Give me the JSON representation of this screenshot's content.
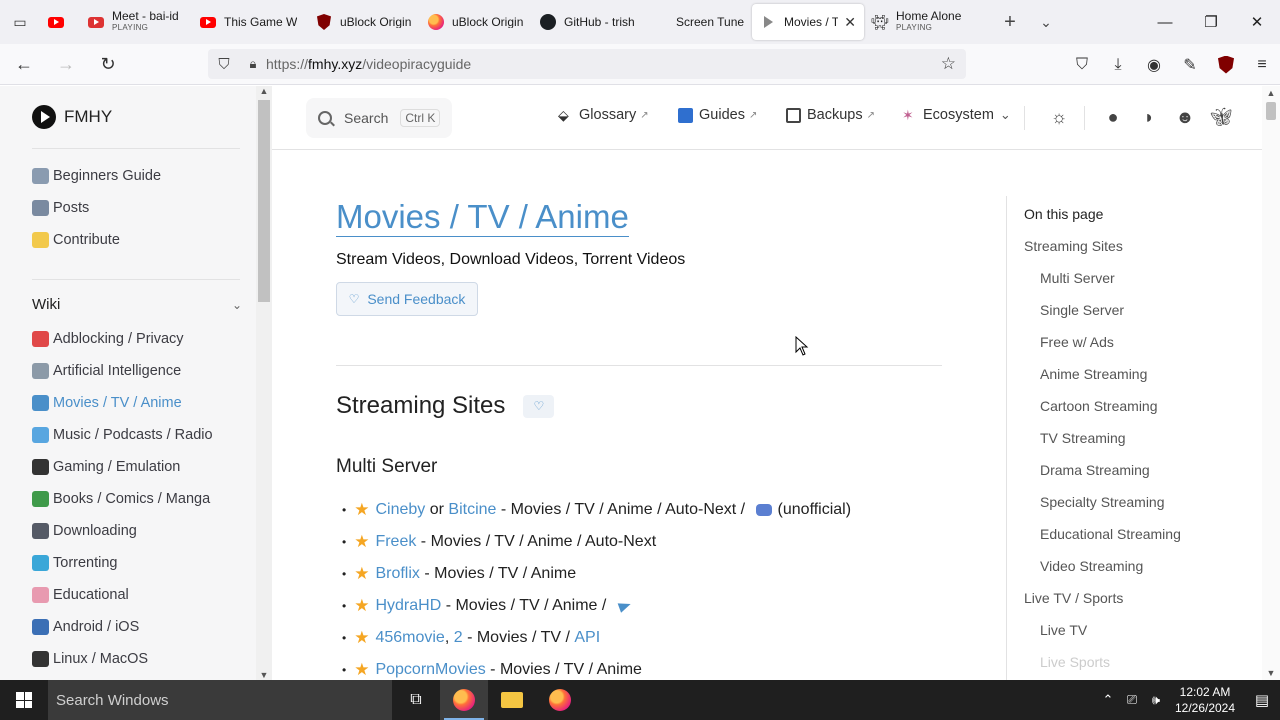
{
  "browser": {
    "tabs": [
      {
        "title": "",
        "icon": "youtube-icon",
        "active": false
      },
      {
        "title": "Meet - bai-id",
        "sub": "PLAYING",
        "icon": "meet-icon",
        "active": false
      },
      {
        "title": "This Game W",
        "icon": "youtube-icon",
        "active": false
      },
      {
        "title": "uBlock Origin",
        "icon": "ublock-icon",
        "active": false
      },
      {
        "title": "uBlock Origin",
        "icon": "firefox-icon",
        "active": false
      },
      {
        "title": "GitHub - trish",
        "icon": "github-icon",
        "active": false
      },
      {
        "title": "Screen Tunes",
        "icon": "screen-tunes-icon",
        "active": false
      },
      {
        "title": "Movies / TV",
        "icon": "play-icon",
        "active": true
      },
      {
        "title": "Home Alone",
        "sub": "PLAYING",
        "icon": "invader-icon",
        "active": false
      }
    ],
    "url_prefix": "https://",
    "url_domain": "fmhy.xyz",
    "url_path": "/videopiracyguide"
  },
  "site": {
    "brand": "FMHY",
    "search_label": "Search",
    "search_kbd": "Ctrl K",
    "nav": {
      "glossary": "Glossary",
      "guides": "Guides",
      "backups": "Backups",
      "ecosystem": "Ecosystem",
      "ext_arrow": "↗",
      "dropdown": "⌄"
    }
  },
  "sidebar": {
    "top_items": [
      {
        "label": "Beginners Guide",
        "color": "#8a9bb0"
      },
      {
        "label": "Posts",
        "color": "#7a8aa0"
      },
      {
        "label": "Contribute",
        "color": "#f2c94c"
      }
    ],
    "section": "Wiki",
    "wiki_items": [
      {
        "label": "Adblocking / Privacy",
        "color": "#e04848"
      },
      {
        "label": "Artificial Intelligence",
        "color": "#8c9aa8"
      },
      {
        "label": "Movies / TV / Anime",
        "color": "#4a8fc9",
        "active": true
      },
      {
        "label": "Music / Podcasts / Radio",
        "color": "#58a6e0"
      },
      {
        "label": "Gaming / Emulation",
        "color": "#333333"
      },
      {
        "label": "Books / Comics / Manga",
        "color": "#3f9a4a"
      },
      {
        "label": "Downloading",
        "color": "#555a66"
      },
      {
        "label": "Torrenting",
        "color": "#3aa7d8"
      },
      {
        "label": "Educational",
        "color": "#e89ab0"
      },
      {
        "label": "Android / iOS",
        "color": "#3b6fb5"
      },
      {
        "label": "Linux / MacOS",
        "color": "#333333"
      }
    ]
  },
  "main": {
    "title": "Movies / TV / Anime",
    "lead": "Stream Videos, Download Videos, Torrent Videos",
    "feedback_label": "Send Feedback",
    "h2": "Streaming Sites",
    "h3": "Multi Server",
    "entries": [
      {
        "parts": [
          {
            "t": "Cineby",
            "link": true
          },
          {
            "t": " or "
          },
          {
            "t": "Bitcine",
            "link": true
          },
          {
            "t": " - Movies / TV / Anime / Auto-Next / "
          },
          {
            "icon": "discord"
          },
          {
            "t": "(unofficial)"
          }
        ]
      },
      {
        "parts": [
          {
            "t": "Freek",
            "link": true
          },
          {
            "t": " - Movies / TV / Anime / Auto-Next"
          }
        ]
      },
      {
        "parts": [
          {
            "t": "Broflix",
            "link": true
          },
          {
            "t": " - Movies / TV / Anime"
          }
        ]
      },
      {
        "parts": [
          {
            "t": "HydraHD",
            "link": true
          },
          {
            "t": " - Movies / TV / Anime / "
          },
          {
            "icon": "telegram"
          }
        ]
      },
      {
        "parts": [
          {
            "t": "456movie",
            "link": true
          },
          {
            "t": ", "
          },
          {
            "t": "2",
            "link": true
          },
          {
            "t": " - Movies / TV / "
          },
          {
            "t": "API",
            "link": true
          }
        ]
      },
      {
        "parts": [
          {
            "t": "PopcornMovies",
            "link": true
          },
          {
            "t": " - Movies / TV / Anime"
          }
        ]
      }
    ]
  },
  "outline": {
    "title": "On this page",
    "items": [
      {
        "label": "Streaming Sites",
        "level": 1
      },
      {
        "label": "Multi Server",
        "level": 2
      },
      {
        "label": "Single Server",
        "level": 2
      },
      {
        "label": "Free w/ Ads",
        "level": 2
      },
      {
        "label": "Anime Streaming",
        "level": 2
      },
      {
        "label": "Cartoon Streaming",
        "level": 2
      },
      {
        "label": "TV Streaming",
        "level": 2
      },
      {
        "label": "Drama Streaming",
        "level": 2
      },
      {
        "label": "Specialty Streaming",
        "level": 2
      },
      {
        "label": "Educational Streaming",
        "level": 2
      },
      {
        "label": "Video Streaming",
        "level": 2
      },
      {
        "label": "Live TV / Sports",
        "level": 1
      },
      {
        "label": "Live TV",
        "level": 2
      },
      {
        "label": "Live Sports",
        "level": 2,
        "faded": true
      }
    ]
  },
  "taskbar": {
    "search_placeholder": "Search Windows",
    "time": "12:02 AM",
    "date": "12/26/2024"
  }
}
